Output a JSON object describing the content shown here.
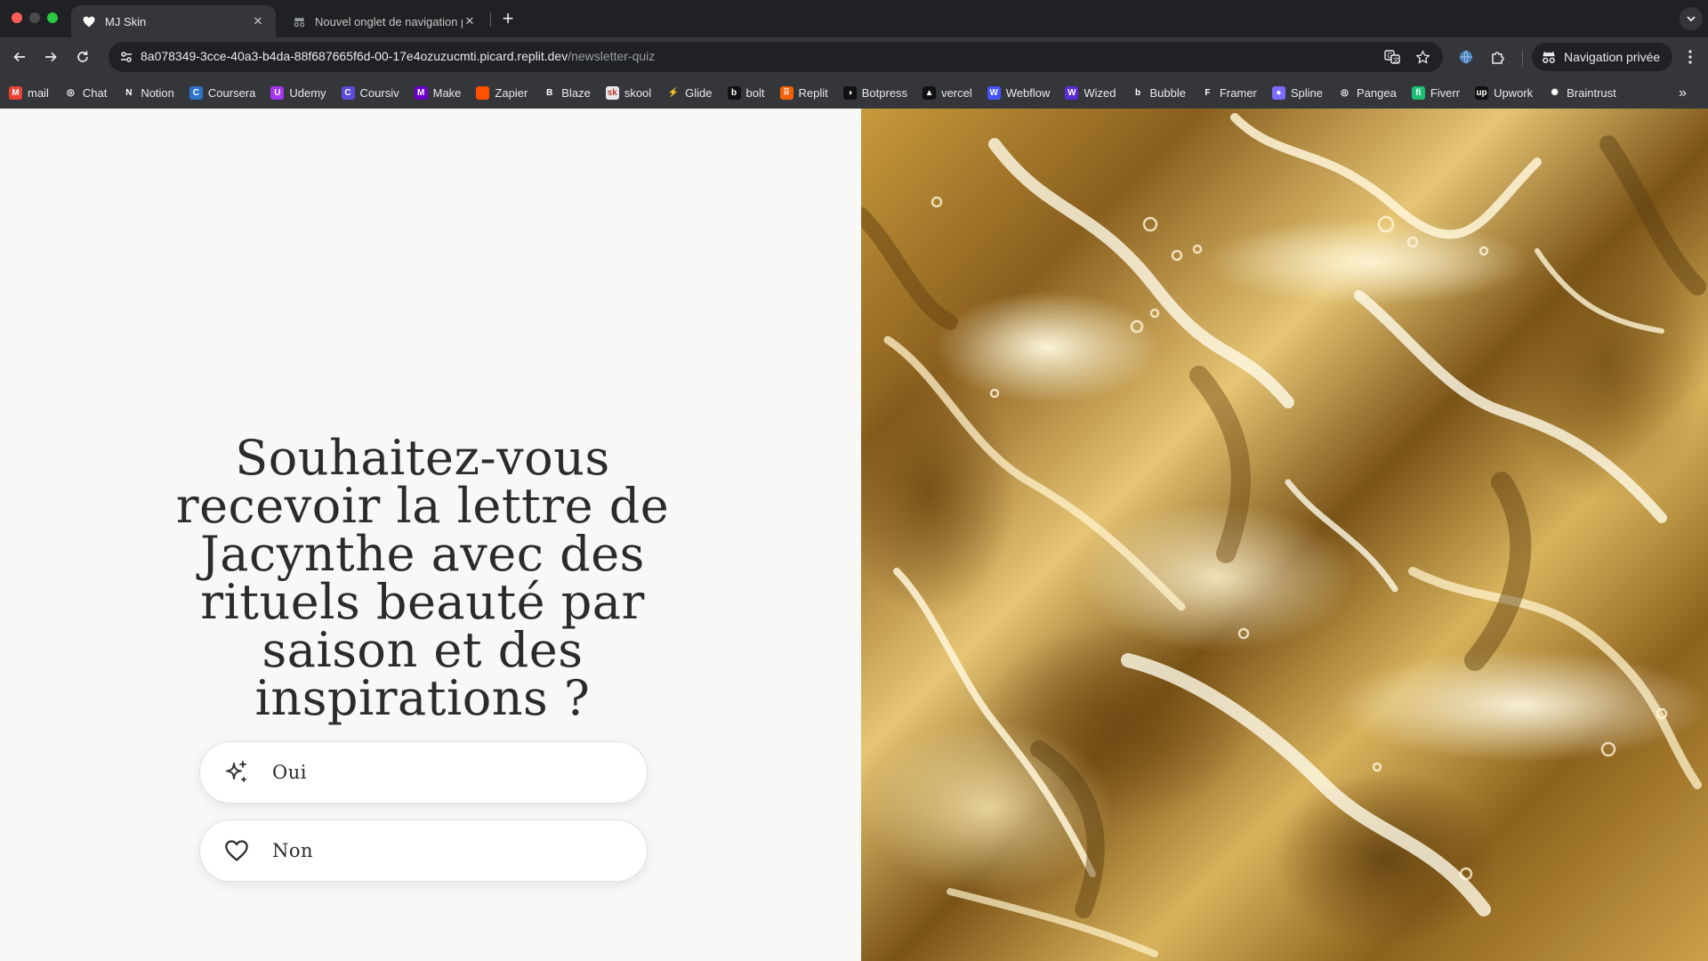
{
  "browser": {
    "tabs": [
      {
        "title": "MJ Skin",
        "active": true
      },
      {
        "title": "Nouvel onglet de navigation privée",
        "active": false
      }
    ],
    "url_host": "8a078349-3cce-40a3-b4da-88f687665f6d-00-17e4ozuzucmti.picard.replit.dev",
    "url_path": "/newsletter-quiz",
    "incognito_label": "Navigation privée",
    "bookmarks": [
      {
        "label": "mail",
        "icon": "gmail-icon",
        "color": "#ea4335",
        "glyph": "M"
      },
      {
        "label": "Chat",
        "icon": "openai-icon",
        "color": "#35363a",
        "glyph": "◎"
      },
      {
        "label": "Notion",
        "icon": "notion-icon",
        "color": "#35363a",
        "glyph": "N"
      },
      {
        "label": "Coursera",
        "icon": "coursera-icon",
        "color": "#2a73cc",
        "glyph": "C"
      },
      {
        "label": "Udemy",
        "icon": "udemy-icon",
        "color": "#a435f0",
        "glyph": "U"
      },
      {
        "label": "Coursiv",
        "icon": "coursiv-icon",
        "color": "#5b4bdb",
        "glyph": "C"
      },
      {
        "label": "Make",
        "icon": "make-icon",
        "color": "#6d00cc",
        "glyph": "M"
      },
      {
        "label": "Zapier",
        "icon": "zapier-icon",
        "color": "#ff4f00",
        "glyph": ""
      },
      {
        "label": "Blaze",
        "icon": "blaze-icon",
        "color": "#35363a",
        "glyph": "B"
      },
      {
        "label": "skool",
        "icon": "skool-icon",
        "color": "#e8eaed",
        "glyph": "sk"
      },
      {
        "label": "Glide",
        "icon": "glide-icon",
        "color": "#35363a",
        "glyph": "⚡"
      },
      {
        "label": "bolt",
        "icon": "bolt-icon",
        "color": "#111111",
        "glyph": "b"
      },
      {
        "label": "Replit",
        "icon": "replit-icon",
        "color": "#f26207",
        "glyph": "⠿"
      },
      {
        "label": "Botpress",
        "icon": "botpress-icon",
        "color": "#111111",
        "glyph": "◑"
      },
      {
        "label": "vercel",
        "icon": "vercel-icon",
        "color": "#111111",
        "glyph": "▲"
      },
      {
        "label": "Webflow",
        "icon": "webflow-icon",
        "color": "#4353ff",
        "glyph": "W"
      },
      {
        "label": "Wized",
        "icon": "wized-icon",
        "color": "#5b2bd9",
        "glyph": "W"
      },
      {
        "label": "Bubble",
        "icon": "bubble-icon",
        "color": "#35363a",
        "glyph": "b"
      },
      {
        "label": "Framer",
        "icon": "framer-icon",
        "color": "#35363a",
        "glyph": "F"
      },
      {
        "label": "Spline",
        "icon": "spline-icon",
        "color": "#7b6cff",
        "glyph": "●"
      },
      {
        "label": "Pangea",
        "icon": "pangea-icon",
        "color": "#35363a",
        "glyph": "◎"
      },
      {
        "label": "Fiverr",
        "icon": "fiverr-icon",
        "color": "#1dbf73",
        "glyph": "fi"
      },
      {
        "label": "Upwork",
        "icon": "upwork-icon",
        "color": "#111111",
        "glyph": "up"
      },
      {
        "label": "Braintrust",
        "icon": "braintrust-icon",
        "color": "#35363a",
        "glyph": "✺"
      }
    ]
  },
  "quiz": {
    "question": "Souhaitez-vous recevoir la lettre de Jacynthe avec des rituels beauté par saison et des inspirations ?",
    "answers": {
      "yes": {
        "label": "Oui",
        "icon": "sparkle-icon"
      },
      "no": {
        "label": "Non",
        "icon": "heart-icon"
      }
    }
  },
  "colors": {
    "page_bg": "#f8f8f7",
    "text": "#2b2b2b",
    "gold": "#c79a3c"
  }
}
